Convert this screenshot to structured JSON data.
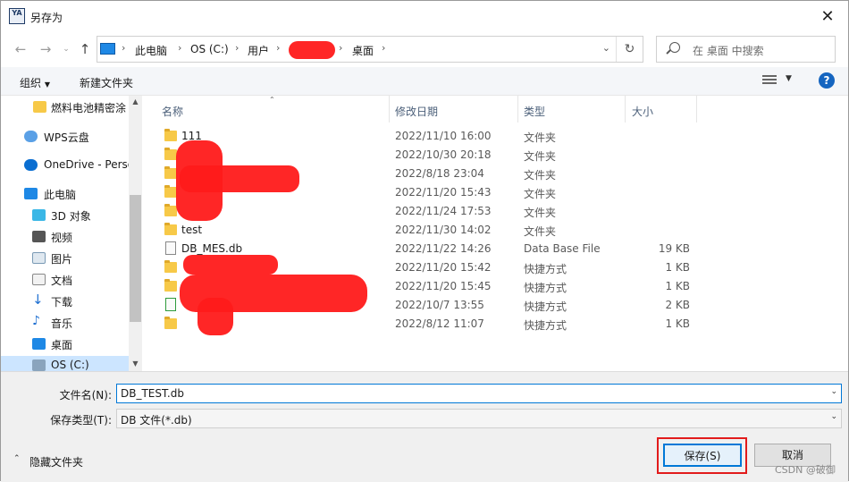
{
  "window": {
    "title": "另存为",
    "app_icon_text": "YA"
  },
  "address_bar": {
    "crumbs": [
      "此电脑",
      "OS (C:)",
      "用户",
      "",
      "桌面"
    ],
    "search_placeholder": "在 桌面 中搜索"
  },
  "toolbar": {
    "organize": "组织",
    "new_folder": "新建文件夹"
  },
  "sidebar": {
    "items": [
      {
        "label": "燃料电池精密涂",
        "icon": "folder-icon"
      },
      {
        "label": "WPS云盘",
        "icon": "cloud-icon"
      },
      {
        "label": "OneDrive - Perso",
        "icon": "onedrive-icon"
      },
      {
        "label": "此电脑",
        "icon": "computer-icon"
      },
      {
        "label": "3D 对象",
        "icon": "cube-icon"
      },
      {
        "label": "视频",
        "icon": "video-icon"
      },
      {
        "label": "图片",
        "icon": "picture-icon"
      },
      {
        "label": "文档",
        "icon": "document-icon"
      },
      {
        "label": "下载",
        "icon": "download-icon"
      },
      {
        "label": "音乐",
        "icon": "music-icon"
      },
      {
        "label": "桌面",
        "icon": "desktop-icon"
      },
      {
        "label": "OS (C:)",
        "icon": "drive-icon"
      }
    ]
  },
  "columns": {
    "name": "名称",
    "date": "修改日期",
    "type": "类型",
    "size": "大小"
  },
  "files": [
    {
      "name": "111",
      "date": "2022/11/10 16:00",
      "type": "文件夹",
      "size": "",
      "icon": "folder-icon"
    },
    {
      "name": "",
      "date": "2022/10/30 20:18",
      "type": "文件夹",
      "size": "",
      "icon": "folder-icon"
    },
    {
      "name": "",
      "date": "2022/8/18 23:04",
      "type": "文件夹",
      "size": "",
      "icon": "folder-sync-icon"
    },
    {
      "name": "",
      "date": "2022/11/20 15:43",
      "type": "文件夹",
      "size": "",
      "icon": "folder-icon"
    },
    {
      "name": "",
      "date": "2022/11/24 17:53",
      "type": "文件夹",
      "size": "",
      "icon": "folder-icon"
    },
    {
      "name": "test",
      "date": "2022/11/30 14:02",
      "type": "文件夹",
      "size": "",
      "icon": "folder-icon"
    },
    {
      "name": "DB_MES.db",
      "date": "2022/11/22 14:26",
      "type": "Data Base File",
      "size": "19 KB",
      "icon": "file-icon"
    },
    {
      "name": "",
      "date": "2022/11/20 15:42",
      "type": "快捷方式",
      "size": "1 KB",
      "icon": "folder-shortcut-icon"
    },
    {
      "name": "",
      "date": "2022/11/20 15:45",
      "type": "快捷方式",
      "size": "1 KB",
      "icon": "folder-shortcut-icon"
    },
    {
      "name": "",
      "date": "2022/10/7 13:55",
      "type": "快捷方式",
      "size": "2 KB",
      "icon": "shortcut-icon"
    },
    {
      "name": "",
      "date": "2022/8/12 11:07",
      "type": "快捷方式",
      "size": "1 KB",
      "icon": "folder-shortcut-icon"
    }
  ],
  "bottom": {
    "filename_label": "文件名(N):",
    "filename_value": "DB_TEST.db",
    "filetype_label": "保存类型(T):",
    "filetype_value": "DB 文件(*.db)",
    "hide_folders": "隐藏文件夹",
    "save": "保存(S)",
    "cancel": "取消",
    "watermark": "CSDN @破御"
  }
}
